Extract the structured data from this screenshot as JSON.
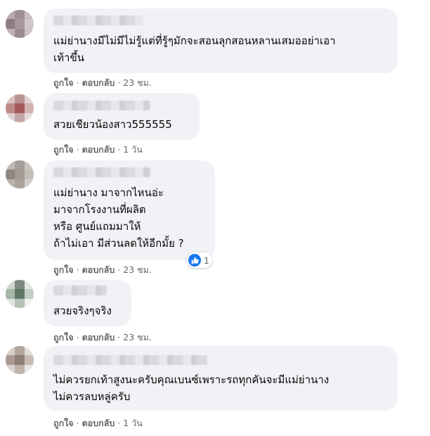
{
  "comments": [
    {
      "text": "แม่ย่านางมีไม่มีไม่รู้แต่ที่รู้ๆมักจะสอนลุกสอนหลานเสมออย่าเอา\nเท้าขึ้น",
      "like_label": "ถูกใจ",
      "reply_label": "ตอบกลับ",
      "time": "23 ชม."
    },
    {
      "text": "สวยเชียวน้องสาว555555",
      "like_label": "ถูกใจ",
      "reply_label": "ตอบกลับ",
      "time": "1 วัน"
    },
    {
      "text": "แม่ย่านาง มาจากไหนอ่ะ\nมาจากโรงงานที่ผลิต\nหรือ ศูนย์แถมมาให้\nถ้าไม่เอา มีส่วนลดให้อีกมั้ย ?",
      "like_label": "ถูกใจ",
      "reply_label": "ตอบกลับ",
      "time": "23 ชม.",
      "reaction_count": "1",
      "reaction_icon": "like-icon"
    },
    {
      "text": "สวยจริงๆจริง",
      "like_label": "ถูกใจ",
      "reply_label": "ตอบกลับ",
      "time": "23 ชม."
    },
    {
      "text": "ไม่ควรยกเท้าสูงนะครับคุณเบนซ์เพราะรถทุกคันจะมีแม่ย่านาง\nไม่ควรลบหลู่ครับ",
      "like_label": "ถูกใจ",
      "reply_label": "ตอบกลับ",
      "time": "1 วัน"
    }
  ],
  "colors": {
    "bubble": "#f0f2f5",
    "meta": "#65676b",
    "accent": "#1877f2"
  }
}
